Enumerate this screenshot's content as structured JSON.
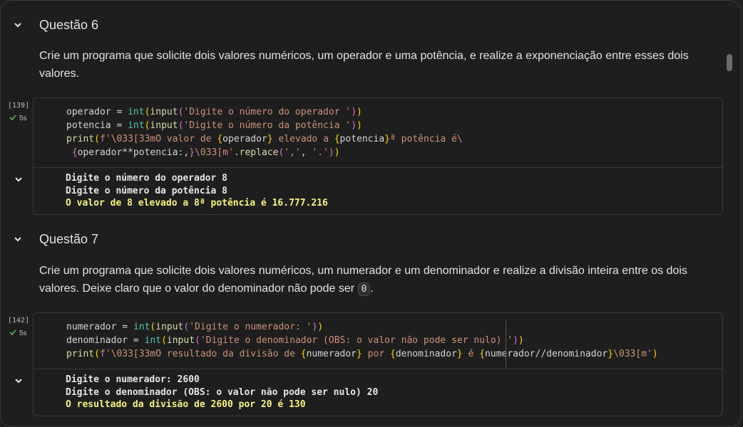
{
  "q6": {
    "heading": "Questão 6",
    "line1": "Crie um programa que solicite dois valores numéricos, um operador e uma potência, e realize a exponenciação entre esses dois",
    "line2": "valores.",
    "exec_count": "[139]",
    "time": "5s",
    "output": [
      "Digite o número do operador 8",
      "Digite o número da potência 8",
      "O valor de 8 elevado a 8ª potência é 16.777.216"
    ]
  },
  "q7": {
    "heading": "Questão 7",
    "line1": "Crie um programa que solicite dois valores numéricos, um numerador e um denominador e realize a divisão inteira entre os dois",
    "line2_pre": "valores. Deixe claro que o valor do denominador não pode ser ",
    "line2_code": "0",
    "line2_post": ".",
    "exec_count": "[142]",
    "time": "5s",
    "output": [
      "Digite o numerador: 2600",
      "Digite o denominador (OBS: o valor não pode ser nulo) 20",
      "O resultado da divisão de 2600 por 20 é 130"
    ]
  },
  "icons": {
    "collapse": "chevron-down-icon",
    "success": "check-icon"
  },
  "colors": {
    "background": "#1e1e1e",
    "highlight_output": "#f6f37b",
    "success": "#5fb760"
  }
}
